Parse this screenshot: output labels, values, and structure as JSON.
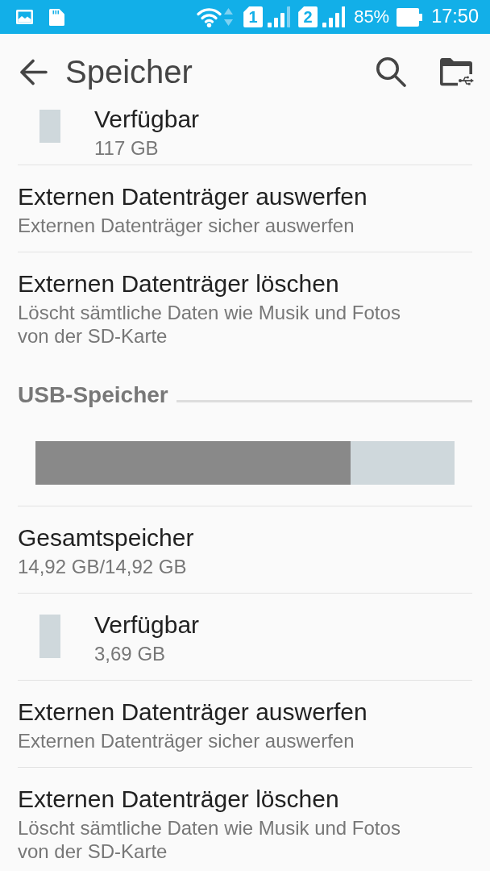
{
  "status_bar": {
    "sims": [
      {
        "label": "1"
      },
      {
        "label": "2"
      }
    ],
    "battery": "85%",
    "time": "17:50"
  },
  "app_bar": {
    "title": "Speicher"
  },
  "sections": [
    {
      "items": [
        {
          "kind": "legend",
          "title": "Verfügbar",
          "subtitle": "117 GB",
          "color": "#cfd8dc"
        },
        {
          "kind": "action",
          "title": "Externen Datenträger auswerfen",
          "subtitle": "Externen Datenträger sicher auswerfen"
        },
        {
          "kind": "action",
          "title": "Externen Datenträger löschen",
          "subtitle": "Löscht sämtliche Daten wie Musik und Fotos von der SD-Karte"
        }
      ]
    },
    {
      "header": "USB-Speicher",
      "items": [
        {
          "kind": "usage_bar",
          "level": 0.752
        },
        {
          "kind": "info",
          "title": "Gesamtspeicher",
          "subtitle": "14,92 GB/14,92 GB"
        },
        {
          "kind": "legend",
          "title": "Verfügbar",
          "subtitle": "3,69 GB",
          "color": "#cfd8dc"
        },
        {
          "kind": "action",
          "title": "Externen Datenträger auswerfen",
          "subtitle": "Externen Datenträger sicher auswerfen"
        },
        {
          "kind": "action",
          "title": "Externen Datenträger löschen",
          "subtitle": "Löscht sämtliche Daten wie Musik und Fotos von der SD-Karte"
        }
      ]
    }
  ]
}
